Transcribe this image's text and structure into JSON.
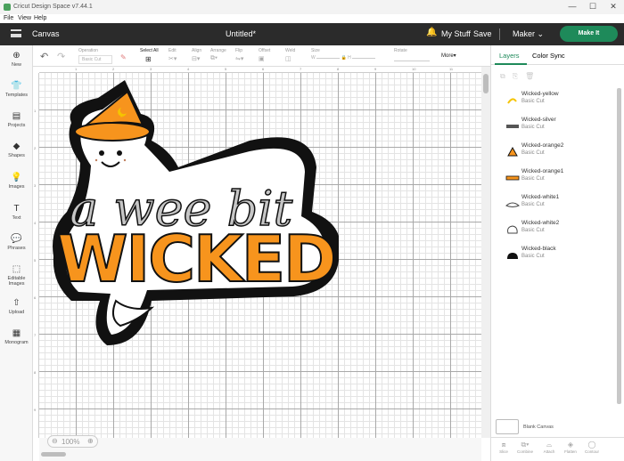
{
  "window": {
    "title": "Cricut Design Space  v7.44.1",
    "controls": [
      "—",
      "☐",
      "✕"
    ]
  },
  "menu": [
    "File",
    "View",
    "Help"
  ],
  "header": {
    "section": "Canvas",
    "document": "Untitled*",
    "my_stuff": "My Stuff",
    "save": "Save",
    "machine": "Maker",
    "machine_chevron": "⌄",
    "make_it": "Make It"
  },
  "nav": [
    {
      "label": "New",
      "icon": "⊕",
      "icon_name": "plus-circle-icon"
    },
    {
      "label": "Templates",
      "icon": "👕",
      "icon_name": "shirt-icon"
    },
    {
      "label": "Projects",
      "icon": "▤",
      "icon_name": "projects-icon"
    },
    {
      "label": "Shapes",
      "icon": "◆",
      "icon_name": "shapes-icon"
    },
    {
      "label": "Images",
      "icon": "💡",
      "icon_name": "bulb-icon"
    },
    {
      "label": "Text",
      "icon": "T",
      "icon_name": "text-icon"
    },
    {
      "label": "Phrases",
      "icon": "💬",
      "icon_name": "speech-bubble-icon"
    },
    {
      "label": "Editable Images",
      "icon": "⬚",
      "icon_name": "editable-images-icon"
    },
    {
      "label": "Upload",
      "icon": "⇧",
      "icon_name": "upload-icon"
    },
    {
      "label": "Monogram",
      "icon": "▦",
      "icon_name": "monogram-icon"
    }
  ],
  "toolbar": {
    "undo": "↶",
    "redo": "↷",
    "operation_label": "Operation",
    "operation_value": "Basic Cut",
    "select_all": "Select All",
    "edit": "Edit",
    "align": "Align",
    "arrange": "Arrange",
    "flip": "Flip",
    "offset": "Offset",
    "weld": "Weld",
    "size": "Size",
    "rotate": "Rotate",
    "more": "More▾",
    "w_label": "W",
    "h_label": "H"
  },
  "rulers": {
    "top": [
      "1",
      "2",
      "3",
      "4",
      "5",
      "6",
      "7",
      "8",
      "9",
      "10",
      "11"
    ],
    "left": [
      "1",
      "2",
      "3",
      "4",
      "5",
      "6",
      "7",
      "8",
      "9"
    ]
  },
  "zoom": {
    "minus": "⊖",
    "value": "100%",
    "plus": "⊕"
  },
  "panel": {
    "tabs": [
      "Layers",
      "Color Sync"
    ],
    "active_tab": "Layers",
    "layers": [
      {
        "name": "Wicked-yellow",
        "op": "Basic Cut",
        "color": "#f5c400"
      },
      {
        "name": "Wicked-silver",
        "op": "Basic Cut",
        "color": "#b0b0b0"
      },
      {
        "name": "Wicked-orange2",
        "op": "Basic Cut",
        "color": "#f7941d"
      },
      {
        "name": "Wicked-orange1",
        "op": "Basic Cut",
        "color": "#f7941d"
      },
      {
        "name": "Wicked-white1",
        "op": "Basic Cut",
        "color": "#ffffff"
      },
      {
        "name": "Wicked-white2",
        "op": "Basic Cut",
        "color": "#ffffff"
      },
      {
        "name": "Wicked-black",
        "op": "Basic Cut",
        "color": "#111111"
      }
    ],
    "blank_canvas": "Blank Canvas",
    "bottom_tools": [
      "Slice",
      "Combine",
      "Attach",
      "Flatten",
      "Contour"
    ]
  },
  "design": {
    "text_top": "a wee bit",
    "text_main": "WICKED",
    "colors": {
      "orange": "#f7941d",
      "silver": "#c6c6c6",
      "black": "#111111",
      "white": "#ffffff",
      "yellow": "#f5c400"
    }
  },
  "accent": "#1e8a5a"
}
